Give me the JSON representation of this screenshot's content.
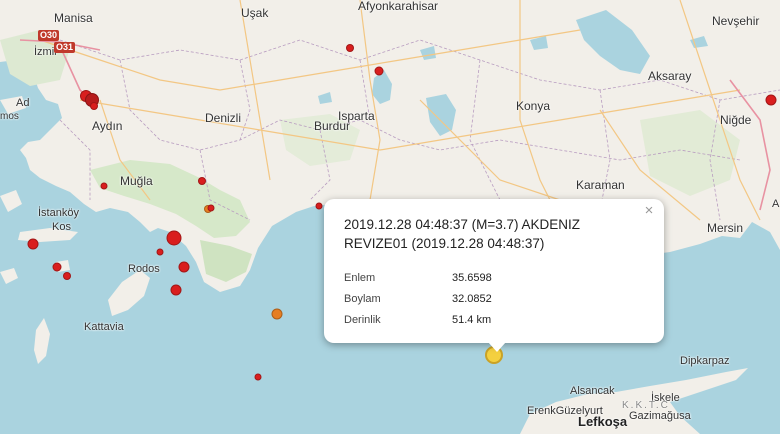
{
  "places": {
    "manisa": "Manisa",
    "izmir": "İzmir",
    "usak": "Uşak",
    "afyonkarahisar": "Afyonkarahisar",
    "aksaray": "Aksaray",
    "nevsehir": "Nevşehir",
    "nigde": "Niğde",
    "aydin": "Aydın",
    "denizli": "Denizli",
    "burdur": "Burdur",
    "isparta": "Isparta",
    "konya": "Konya",
    "mugla": "Muğla",
    "karaman": "Karaman",
    "istankoy": "İstanköy",
    "kos": "Kos",
    "rodos": "Rodos",
    "kattavia": "Kattavia",
    "mersin": "Mersin",
    "dipkarpaz": "Dipkarpaz",
    "alsancak": "Alsancak",
    "iskele": "İskele",
    "erenkguzelyurt": "ErenkGüzelyurt",
    "kktc": "K.K.T.C",
    "gazimagusa": "Gazimağusa",
    "lefkosa": "Lefkoşa",
    "ad_fragment": "Ad",
    "mos_fragment": "mos",
    "a_fragment": "A"
  },
  "road_shields": [
    "O30",
    "O31"
  ],
  "quake_colors": {
    "recent_selected": "#f4d03f",
    "orange": "#e67e22",
    "red": "#d91e1e",
    "dark_red": "#b71c1c"
  },
  "popup": {
    "title": "2019.12.28 04:48:37 (M=3.7) AKDENIZ REVIZE01 (2019.12.28 04:48:37)",
    "close_icon": "×",
    "rows": [
      {
        "label": "Enlem",
        "value": "35.6598"
      },
      {
        "label": "Boylam",
        "value": "32.0852"
      },
      {
        "label": "Derinlik",
        "value": "51.4 km"
      }
    ]
  }
}
